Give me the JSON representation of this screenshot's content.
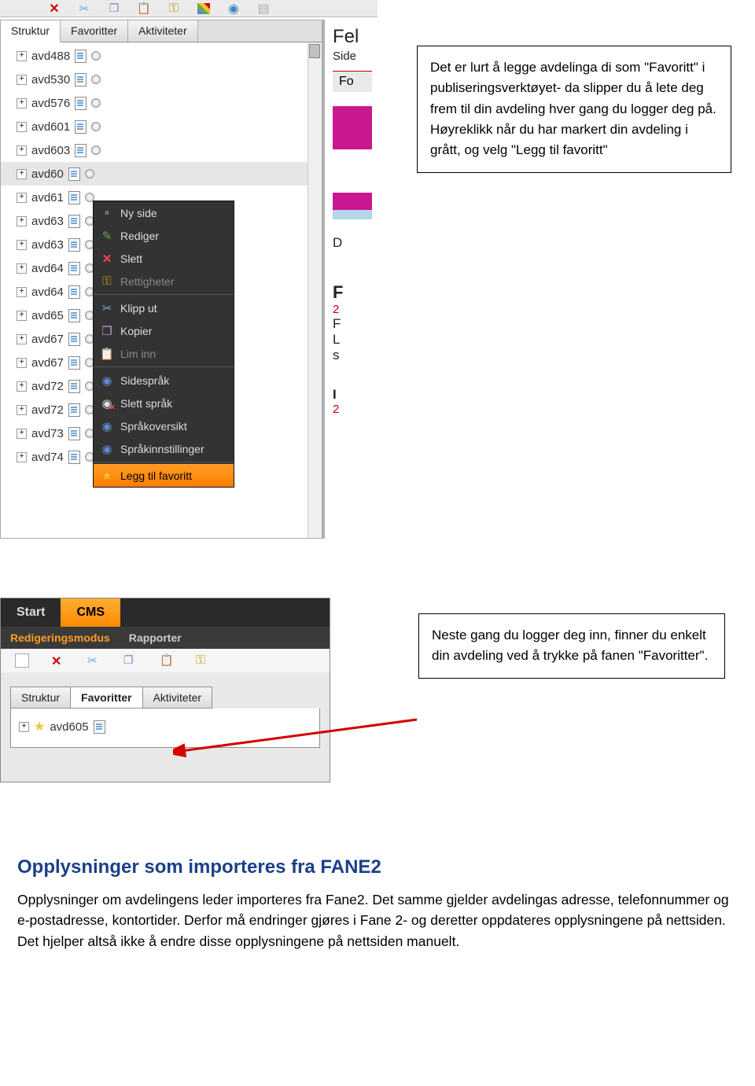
{
  "screenshot1": {
    "tabs": [
      "Struktur",
      "Favoritter",
      "Aktiviteter"
    ],
    "tree": [
      "avd488",
      "avd530",
      "avd576",
      "avd601",
      "avd603",
      "avd60",
      "avd61",
      "avd63",
      "avd63",
      "avd64",
      "avd64",
      "avd65",
      "avd67",
      "avd67",
      "avd72",
      "avd72",
      "avd73",
      "avd74"
    ],
    "content_fragments": {
      "fel": "Fel",
      "side": "Side",
      "fo": "Fo",
      "d": "D",
      "f": "F",
      "n2": "2",
      "fcap": "F",
      "l": "L",
      "s": "s",
      "i": "I"
    }
  },
  "context_menu": {
    "items": [
      {
        "label": "Ny side",
        "icon": "page",
        "dim": false
      },
      {
        "label": "Rediger",
        "icon": "pen",
        "dim": false
      },
      {
        "label": "Slett",
        "icon": "x",
        "dim": false
      },
      {
        "label": "Rettigheter",
        "icon": "key",
        "dim": true
      },
      {
        "sep": true
      },
      {
        "label": "Klipp ut",
        "icon": "sci",
        "dim": false
      },
      {
        "label": "Kopier",
        "icon": "cp",
        "dim": false
      },
      {
        "label": "Lim inn",
        "icon": "pa",
        "dim": true
      },
      {
        "sep": true
      },
      {
        "label": "Sidespråk",
        "icon": "gb",
        "dim": false
      },
      {
        "label": "Slett språk",
        "icon": "gx",
        "dim": false
      },
      {
        "label": "Språkoversikt",
        "icon": "gb",
        "dim": false
      },
      {
        "label": "Språkinnstillinger",
        "icon": "gb",
        "dim": false
      },
      {
        "sep": true
      },
      {
        "label": "Legg til favoritt",
        "icon": "st",
        "dim": false,
        "hl": true
      }
    ]
  },
  "callout1": "Det er lurt å legge avdelinga di som \"Favoritt\" i publiseringsverktøyet- da slipper du å lete deg frem til din avdeling hver gang du logger deg på. Høyreklikk når du har markert din avdeling i grått, og velg \"Legg til favoritt\"",
  "callout2": "Neste gang du logger deg inn, finner du enkelt din avdeling ved å trykke på fanen \"Favoritter\".",
  "screenshot2": {
    "top_tabs": [
      "Start",
      "CMS"
    ],
    "sub_tabs": [
      "Redigeringsmodus",
      "Rapporter"
    ],
    "lower_tabs": [
      "Struktur",
      "Favoritter",
      "Aktiviteter"
    ],
    "fav_item": "avd605"
  },
  "body": {
    "heading": "Opplysninger som importeres fra FANE2",
    "text": "Opplysninger om avdelingens leder importeres fra Fane2. Det samme gjelder avdelingas adresse, telefonnummer og e-postadresse, kontortider. Derfor må endringer gjøres i Fane 2- og deretter oppdateres opplysningene på nettsiden. Det hjelper altså ikke å endre disse opplysningene på nettsiden manuelt."
  }
}
